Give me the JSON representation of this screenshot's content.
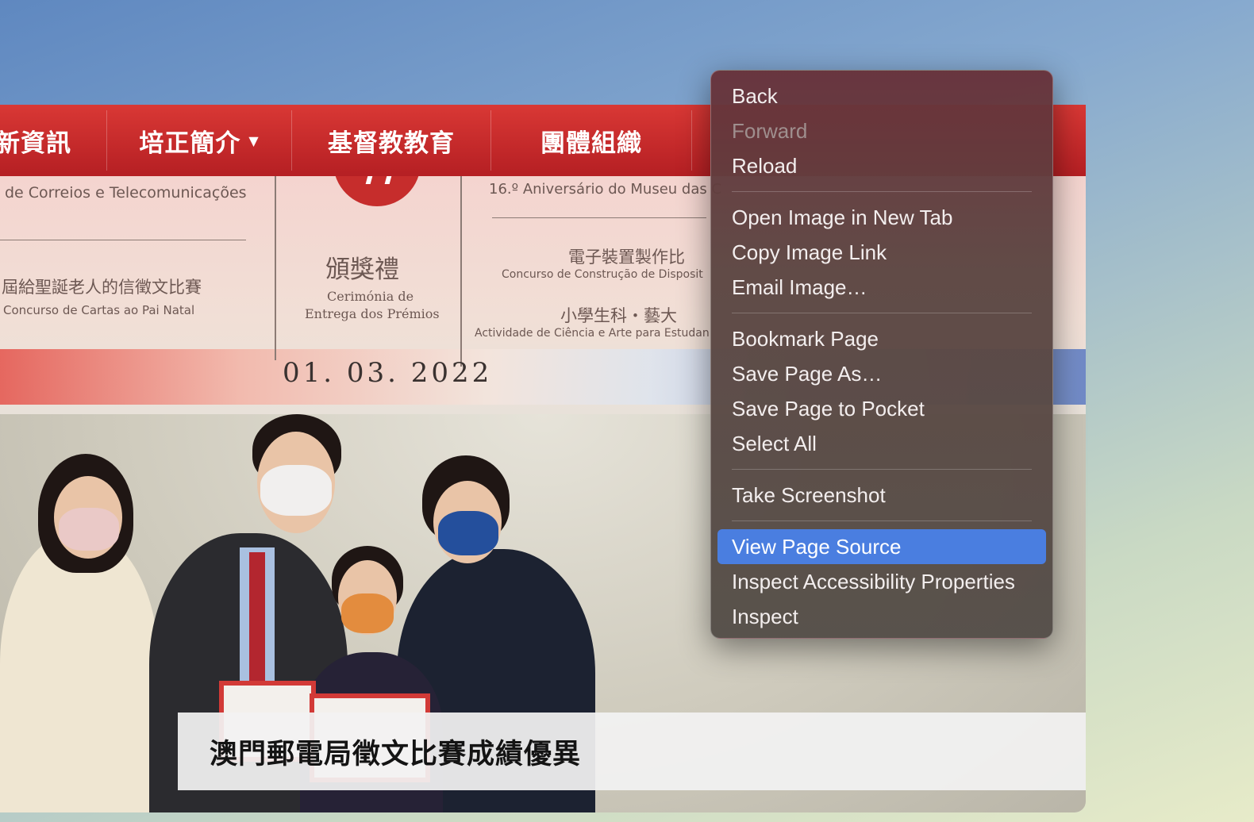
{
  "nav": {
    "items": [
      {
        "label": "新資訊"
      },
      {
        "label": "培正簡介",
        "arrow": "▼"
      },
      {
        "label": "基督教教育"
      },
      {
        "label": "團體組織"
      }
    ]
  },
  "poster": {
    "left_top": "de Correios e Telecomunicações",
    "left_cn": "屆給聖誕老人的信徵文比賽",
    "left_pt": "Concurso de Cartas ao Pai Natal",
    "center_cn": "頒獎禮",
    "center_pt1": "Cerimónia de",
    "center_pt2": "Entrega dos Prémios",
    "right_top": "16.º Aniversário do Museu das C",
    "right_cn1": "電子裝置製作比",
    "right_pt1": "Concurso de Construção de Disposit",
    "right_cn2": "小學生科・藝大",
    "right_pt2": "Actividade de Ciência e Arte para Estudan",
    "date": "01. 03. 2022"
  },
  "caption": {
    "text": "澳門郵電局徵文比賽成績優異"
  },
  "context_menu": {
    "groups": [
      [
        {
          "label": "Back",
          "disabled": false,
          "selected": false
        },
        {
          "label": "Forward",
          "disabled": true,
          "selected": false
        },
        {
          "label": "Reload",
          "disabled": false,
          "selected": false
        }
      ],
      [
        {
          "label": "Open Image in New Tab",
          "disabled": false,
          "selected": false
        },
        {
          "label": "Copy Image Link",
          "disabled": false,
          "selected": false
        },
        {
          "label": "Email Image…",
          "disabled": false,
          "selected": false
        }
      ],
      [
        {
          "label": "Bookmark Page",
          "disabled": false,
          "selected": false
        },
        {
          "label": "Save Page As…",
          "disabled": false,
          "selected": false
        },
        {
          "label": "Save Page to Pocket",
          "disabled": false,
          "selected": false
        },
        {
          "label": "Select All",
          "disabled": false,
          "selected": false
        }
      ],
      [
        {
          "label": "Take Screenshot",
          "disabled": false,
          "selected": false
        }
      ],
      [
        {
          "label": "View Page Source",
          "disabled": false,
          "selected": true
        },
        {
          "label": "Inspect Accessibility Properties",
          "disabled": false,
          "selected": false
        },
        {
          "label": "Inspect",
          "disabled": false,
          "selected": false
        }
      ]
    ]
  },
  "colors": {
    "nav_red": "#c8292b",
    "menu_highlight": "#4a7ee0"
  }
}
